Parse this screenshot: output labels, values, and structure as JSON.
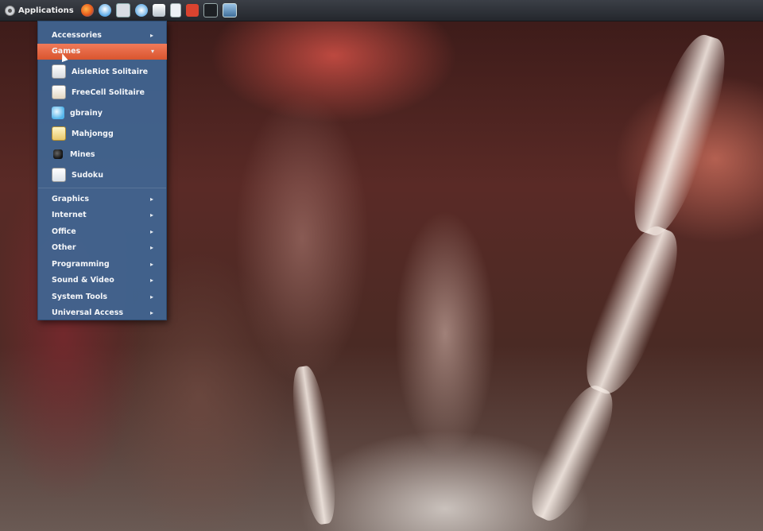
{
  "top_panel": {
    "applications_label": "Applications",
    "launchers": [
      {
        "icon": "firefox-icon"
      },
      {
        "icon": "weather-icon"
      },
      {
        "icon": "chat-icon"
      },
      {
        "icon": "power-icon"
      },
      {
        "icon": "calculator-icon"
      },
      {
        "icon": "document-icon"
      },
      {
        "icon": "red-folder-icon"
      },
      {
        "icon": "terminal-icon"
      },
      {
        "icon": "image-viewer-icon"
      }
    ]
  },
  "menu": {
    "categories": [
      {
        "label": "Accessories",
        "arrow": "▸"
      },
      {
        "label": "Games",
        "arrow": "▾",
        "active": true
      },
      {
        "label": "Graphics",
        "arrow": "▸"
      },
      {
        "label": "Internet",
        "arrow": "▸"
      },
      {
        "label": "Office",
        "arrow": "▸"
      },
      {
        "label": "Other",
        "arrow": "▸"
      },
      {
        "label": "Programming",
        "arrow": "▸"
      },
      {
        "label": "Sound & Video",
        "arrow": "▸"
      },
      {
        "label": "System Tools",
        "arrow": "▸"
      },
      {
        "label": "Universal Access",
        "arrow": "▸"
      }
    ],
    "games": [
      {
        "label": "AisleRiot Solitaire",
        "icon": "cards-icon"
      },
      {
        "label": "FreeCell Solitaire",
        "icon": "cards-icon"
      },
      {
        "label": "gbrainy",
        "icon": "brain-icon"
      },
      {
        "label": "Mahjongg",
        "icon": "tiles-icon"
      },
      {
        "label": "Mines",
        "icon": "mine-icon"
      },
      {
        "label": "Sudoku",
        "icon": "grid-icon"
      }
    ]
  },
  "colors": {
    "menu_background": "#406694",
    "active_item": "#e4623d",
    "panel": "#2b2e34"
  }
}
